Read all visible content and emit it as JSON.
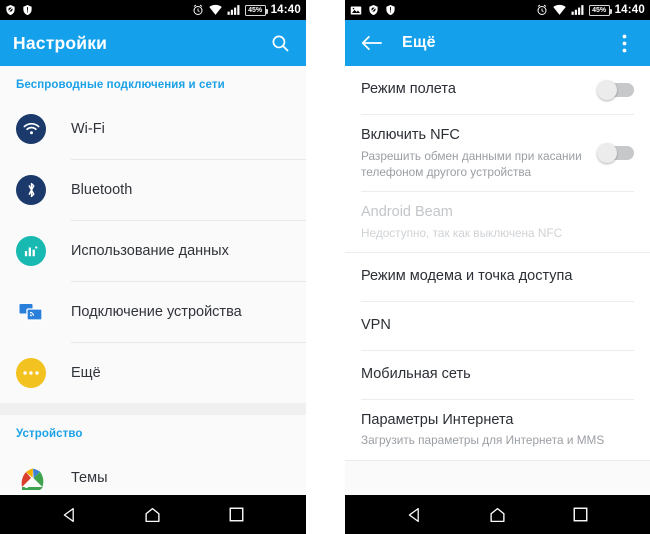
{
  "statusbar": {
    "time": "14:40",
    "battery_percent": "45",
    "battery_label": "45%",
    "left_icons_panel1": [
      "shield-icon",
      "warning-icon"
    ],
    "left_icons_panel2": [
      "screenshot-icon",
      "shield-icon",
      "warning-icon"
    ],
    "right_icons": [
      "alarm-icon",
      "wifi-icon",
      "signal-icon",
      "battery-icon"
    ]
  },
  "panel_left": {
    "appbar": {
      "title": "Настройки",
      "search_icon": "search-icon"
    },
    "sections": [
      {
        "header": "Беспроводные подключения и сети",
        "items": [
          {
            "label": "Wi-Fi",
            "icon": "wifi-icon",
            "icon_color": "#1b3a6b"
          },
          {
            "label": "Bluetooth",
            "icon": "bluetooth-icon",
            "icon_color": "#1b3a6b"
          },
          {
            "label": "Использование данных",
            "icon": "data-usage-icon",
            "icon_color": "#18b9b0"
          },
          {
            "label": "Подключение устройства",
            "icon": "device-cast-icon",
            "icon_color": "#2a7fdb"
          },
          {
            "label": "Ещё",
            "icon": "more-dots-icon",
            "icon_color": "#f2c220"
          }
        ]
      },
      {
        "header": "Устройство",
        "items": [
          {
            "label": "Темы",
            "icon": "themes-palette-icon",
            "icon_color": "#4a90d9"
          }
        ]
      }
    ]
  },
  "panel_right": {
    "appbar": {
      "back_icon": "back-arrow-icon",
      "title": "Ещё",
      "overflow_icon": "overflow-menu-icon"
    },
    "items": [
      {
        "title": "Режим полета",
        "subtitle": "",
        "type": "toggle",
        "toggle_on": false,
        "disabled": false
      },
      {
        "title": "Включить NFC",
        "subtitle": "Разрешить обмен данными при касании телефоном другого устройства",
        "type": "toggle",
        "toggle_on": false,
        "disabled": false
      },
      {
        "title": "Android Beam",
        "subtitle": "Недоступно, так как выключена NFC",
        "type": "plain",
        "toggle_on": false,
        "disabled": true
      },
      {
        "title": "Режим модема и точка доступа",
        "subtitle": "",
        "type": "plain",
        "toggle_on": false,
        "disabled": false
      },
      {
        "title": "VPN",
        "subtitle": "",
        "type": "plain",
        "toggle_on": false,
        "disabled": false
      },
      {
        "title": "Мобильная сеть",
        "subtitle": "",
        "type": "plain",
        "toggle_on": false,
        "disabled": false
      },
      {
        "title": "Параметры Интернета",
        "subtitle": "Загрузить параметры для Интернета и MMS",
        "type": "plain",
        "toggle_on": false,
        "disabled": false
      }
    ]
  },
  "navbar": {
    "back_label": "back-nav-button",
    "home_label": "home-nav-button",
    "recents_label": "recents-nav-button"
  },
  "colors": {
    "accent_blue": "#15a0ec",
    "section_header_blue": "#1ba1e8",
    "list_bg": "#fafafa",
    "divider": "#e8e8e8"
  }
}
